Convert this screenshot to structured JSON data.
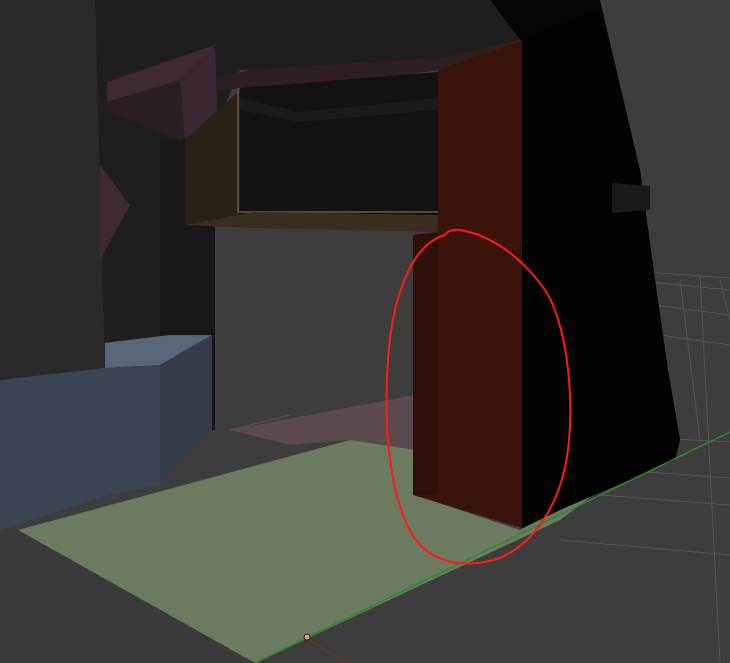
{
  "viewport": {
    "type": "3d-viewport",
    "shading": "solid",
    "annotation": {
      "shape": "freehand-ellipse",
      "color": "#ff1a1a"
    },
    "colors": {
      "background": "#3d3d3d",
      "grid": "#555555",
      "ground_selected": "#6b7a60",
      "red_pillar": "#3a140c",
      "blue_block": "#3a4452",
      "purple_block": "#3d2a33",
      "tan_frame": "#4a3a2a",
      "axis_x": "#c03030",
      "axis_y": "#2a8a2a",
      "origin_point": "#e0a060"
    }
  }
}
